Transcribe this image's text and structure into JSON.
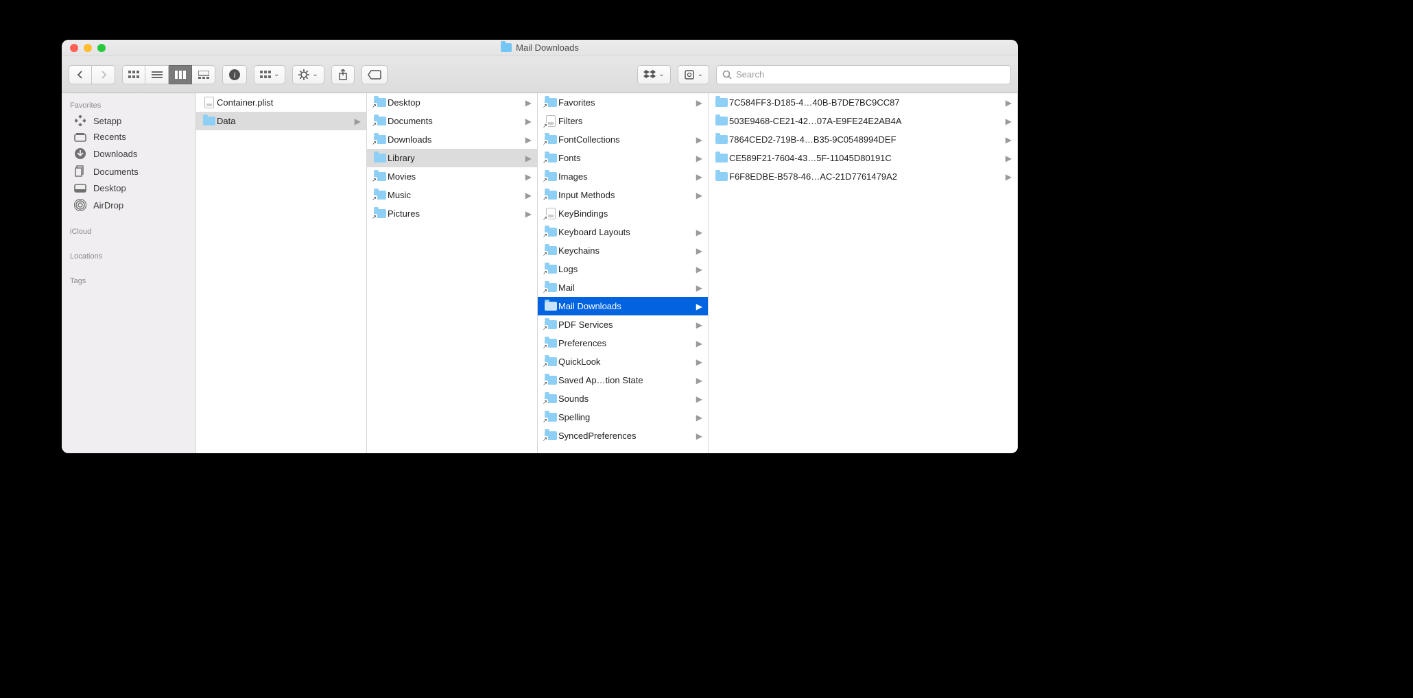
{
  "window": {
    "title": "Mail Downloads"
  },
  "toolbar": {
    "search_placeholder": "Search"
  },
  "sidebar": {
    "sections": [
      {
        "label": "Favorites",
        "items": [
          {
            "name": "Setapp",
            "icon": "setapp"
          },
          {
            "name": "Recents",
            "icon": "recents"
          },
          {
            "name": "Downloads",
            "icon": "downloads"
          },
          {
            "name": "Documents",
            "icon": "documents"
          },
          {
            "name": "Desktop",
            "icon": "desktop"
          },
          {
            "name": "AirDrop",
            "icon": "airdrop"
          }
        ]
      },
      {
        "label": "iCloud",
        "items": []
      },
      {
        "label": "Locations",
        "items": []
      },
      {
        "label": "Tags",
        "items": []
      }
    ]
  },
  "columns": [
    [
      {
        "name": "Container.plist",
        "type": "plist",
        "hasChildren": false
      },
      {
        "name": "Data",
        "type": "folder",
        "hasChildren": true,
        "selected": "grey"
      }
    ],
    [
      {
        "name": "Desktop",
        "type": "alias-folder",
        "hasChildren": true
      },
      {
        "name": "Documents",
        "type": "alias-folder",
        "hasChildren": true
      },
      {
        "name": "Downloads",
        "type": "alias-folder",
        "hasChildren": true
      },
      {
        "name": "Library",
        "type": "folder",
        "hasChildren": true,
        "selected": "grey"
      },
      {
        "name": "Movies",
        "type": "alias-folder",
        "hasChildren": true
      },
      {
        "name": "Music",
        "type": "alias-folder",
        "hasChildren": true
      },
      {
        "name": "Pictures",
        "type": "alias-folder",
        "hasChildren": true
      }
    ],
    [
      {
        "name": "Favorites",
        "type": "alias-folder",
        "hasChildren": true
      },
      {
        "name": "Filters",
        "type": "alias-doc",
        "hasChildren": false
      },
      {
        "name": "FontCollections",
        "type": "alias-folder",
        "hasChildren": true
      },
      {
        "name": "Fonts",
        "type": "alias-folder",
        "hasChildren": true
      },
      {
        "name": "Images",
        "type": "alias-folder",
        "hasChildren": true
      },
      {
        "name": "Input Methods",
        "type": "alias-folder",
        "hasChildren": true
      },
      {
        "name": "KeyBindings",
        "type": "alias-doc",
        "hasChildren": false
      },
      {
        "name": "Keyboard Layouts",
        "type": "alias-folder",
        "hasChildren": true
      },
      {
        "name": "Keychains",
        "type": "alias-folder",
        "hasChildren": true
      },
      {
        "name": "Logs",
        "type": "alias-folder",
        "hasChildren": true
      },
      {
        "name": "Mail",
        "type": "alias-folder",
        "hasChildren": true
      },
      {
        "name": "Mail Downloads",
        "type": "folder",
        "hasChildren": true,
        "selected": "blue"
      },
      {
        "name": "PDF Services",
        "type": "alias-folder",
        "hasChildren": true
      },
      {
        "name": "Preferences",
        "type": "alias-folder",
        "hasChildren": true
      },
      {
        "name": "QuickLook",
        "type": "alias-folder",
        "hasChildren": true
      },
      {
        "name": "Saved Ap…tion State",
        "type": "alias-folder",
        "hasChildren": true
      },
      {
        "name": "Sounds",
        "type": "alias-folder",
        "hasChildren": true
      },
      {
        "name": "Spelling",
        "type": "alias-folder",
        "hasChildren": true
      },
      {
        "name": "SyncedPreferences",
        "type": "alias-folder",
        "hasChildren": true
      }
    ],
    [
      {
        "name": "7C584FF3-D185-4…40B-B7DE7BC9CC87",
        "type": "folder",
        "hasChildren": true
      },
      {
        "name": "503E9468-CE21-42…07A-E9FE24E2AB4A",
        "type": "folder",
        "hasChildren": true
      },
      {
        "name": "7864CED2-719B-4…B35-9C0548994DEF",
        "type": "folder",
        "hasChildren": true
      },
      {
        "name": "CE589F21-7604-43…5F-11045D80191C",
        "type": "folder",
        "hasChildren": true
      },
      {
        "name": "F6F8EDBE-B578-46…AC-21D7761479A2",
        "type": "folder",
        "hasChildren": true
      }
    ]
  ]
}
